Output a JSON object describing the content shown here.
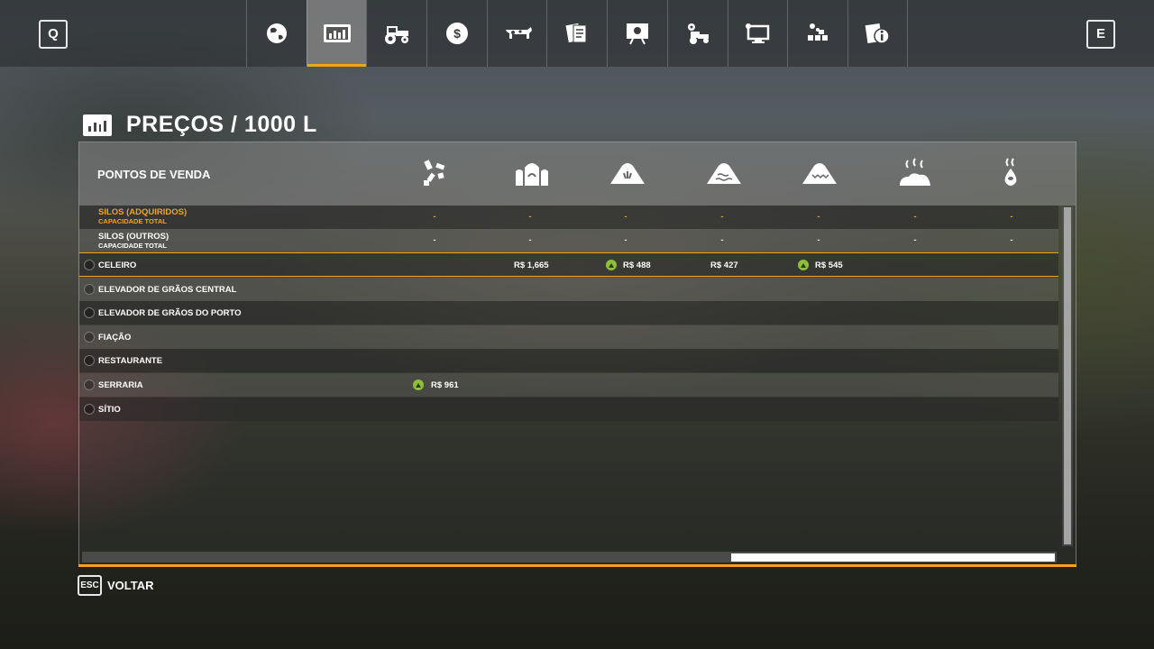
{
  "topbar": {
    "prev_key": "Q",
    "next_key": "E",
    "tabs": [
      {
        "icon": "globe-icon",
        "active": false
      },
      {
        "icon": "prices-chart-icon",
        "active": true
      },
      {
        "icon": "tractor-icon",
        "active": false
      },
      {
        "icon": "money-icon",
        "active": false
      },
      {
        "icon": "cow-icon",
        "active": false
      },
      {
        "icon": "contracts-icon",
        "active": false
      },
      {
        "icon": "tutorial-board-icon",
        "active": false
      },
      {
        "icon": "vehicle-settings-icon",
        "active": false
      },
      {
        "icon": "computer-icon",
        "active": false
      },
      {
        "icon": "production-icon",
        "active": false
      },
      {
        "icon": "help-info-icon",
        "active": false
      }
    ]
  },
  "page": {
    "title": "PREÇOS / 1000 L",
    "accent_color": "#f3a21b",
    "positive_color": "#8dbe3c"
  },
  "table": {
    "column_header": "PONTOS DE VENDA",
    "fill_types": [
      "wood-chips-icon",
      "wool-icon",
      "wheat-icon",
      "barley-icon",
      "canola-icon",
      "manure-icon",
      "liquid-manure-icon"
    ],
    "silos": [
      {
        "label": "SILOS (ADQUIRIDOS)",
        "sublabel": "CAPACIDADE TOTAL",
        "highlight": true,
        "values": [
          "-",
          "-",
          "-",
          "-",
          "-",
          "-",
          "-"
        ]
      },
      {
        "label": "SILOS (OUTROS)",
        "sublabel": "CAPACIDADE TOTAL",
        "highlight": false,
        "values": [
          "-",
          "-",
          "-",
          "-",
          "-",
          "-",
          "-"
        ]
      }
    ],
    "selling_points": [
      {
        "name": "CELEIRO",
        "prices": [
          "",
          "R$ 1,665",
          "R$ 488",
          "R$ 427",
          "R$ 545",
          "",
          ""
        ],
        "trend_up": [
          false,
          false,
          true,
          false,
          true,
          false,
          false
        ]
      },
      {
        "name": "ELEVADOR DE GRÃOS CENTRAL",
        "prices": [
          "",
          "",
          "",
          "",
          "",
          "",
          ""
        ],
        "trend_up": [
          false,
          false,
          false,
          false,
          false,
          false,
          false
        ]
      },
      {
        "name": "ELEVADOR DE GRÃOS DO PORTO",
        "prices": [
          "",
          "",
          "",
          "",
          "",
          "",
          ""
        ],
        "trend_up": [
          false,
          false,
          false,
          false,
          false,
          false,
          false
        ]
      },
      {
        "name": "FIAÇÃO",
        "prices": [
          "",
          "",
          "",
          "",
          "",
          "",
          ""
        ],
        "trend_up": [
          false,
          false,
          false,
          false,
          false,
          false,
          false
        ]
      },
      {
        "name": "RESTAURANTE",
        "prices": [
          "",
          "",
          "",
          "",
          "",
          "",
          ""
        ],
        "trend_up": [
          false,
          false,
          false,
          false,
          false,
          false,
          false
        ]
      },
      {
        "name": "SERRARIA",
        "prices": [
          "R$ 961",
          "",
          "",
          "",
          "",
          "",
          ""
        ],
        "trend_up": [
          true,
          false,
          false,
          false,
          false,
          false,
          false
        ]
      },
      {
        "name": "SÍTIO",
        "prices": [
          "",
          "",
          "",
          "",
          "",
          "",
          ""
        ],
        "trend_up": [
          false,
          false,
          false,
          false,
          false,
          false,
          false
        ]
      }
    ]
  },
  "footer": {
    "back_key": "ESC",
    "back_label": "VOLTAR"
  }
}
